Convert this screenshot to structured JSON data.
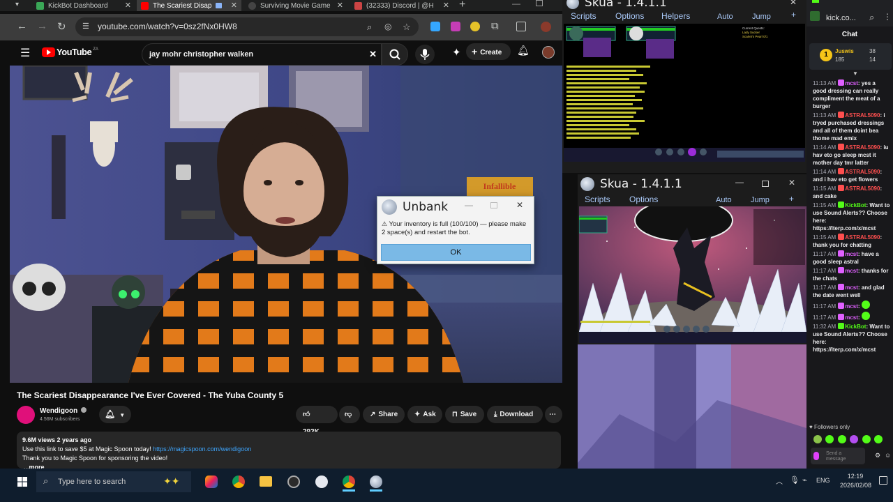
{
  "browser": {
    "tabs": [
      {
        "label": "KickBot Dashboard",
        "color": "#3aa757"
      },
      {
        "label": "The Scariest Disap",
        "color": "#ff0000"
      },
      {
        "label": "Surviving Movie Game",
        "color": "#444"
      },
      {
        "label": "(32333) Discord | @H",
        "color": "#5865f2"
      }
    ],
    "url": "youtube.com/watch?v=0sz2fNx0HW8"
  },
  "youtube": {
    "logo": "YouTube",
    "region": "ZA",
    "search_value": "jay mohr christopher walken",
    "create_label": "Create",
    "video_title": "The Scariest Disappearance I've Ever Covered - The Yuba County 5",
    "channel_name": "Wendigoon",
    "subscribers": "4.56M subscribers",
    "likes": "293K",
    "share_label": "Share",
    "ask_label": "Ask",
    "save_label": "Save",
    "download_label": "Download",
    "views_date": "9.6M views  2 years ago",
    "desc_line1": "Use this link to save $5 at Magic Spoon today!",
    "desc_link": "https://magicspoon.com/wendigoon",
    "desc_line2": "Thank you to Magic Spoon for sponsoring the video!",
    "more": "...more",
    "poster_text": "Infallible"
  },
  "dialog": {
    "title": "Unbank",
    "message": "Your inventory is full (100/100) — please make 2 space(s) and restart the bot.",
    "ok_label": "OK"
  },
  "skua1": {
    "title": "Skua - 1.4.1.1",
    "menu": [
      "Scripts",
      "Options",
      "Helpers"
    ],
    "auto": "Auto",
    "jump": "Jump",
    "quest_title": "Current Quests:",
    "quests": [
      "Lady Sucker",
      "Scarlet's Pearl 0/1"
    ]
  },
  "skua2": {
    "title": "Skua - 1.4.1.1",
    "menu": [
      "Scripts",
      "Options"
    ],
    "auto": "Auto",
    "jump": "Jump"
  },
  "chat": {
    "header": "kick.co...",
    "title": "Chat",
    "pinned_user": "Juswis",
    "pinned_stats": [
      "38",
      "185",
      "14"
    ],
    "messages": [
      {
        "time": "11:13 AM",
        "user": "mcst",
        "color": "#e060ff",
        "text": "yes a good dressing can really compliment the meat of a burger"
      },
      {
        "time": "11:13 AM",
        "user": "ASTRAL5090",
        "color": "#ff4f4f",
        "text": "i tryed purchased dressings and all of them doint bea thome mad emix"
      },
      {
        "time": "11:14 AM",
        "user": "ASTRAL5090",
        "color": "#ff4f4f",
        "text": "iu hav eto go sleep mcst it mother day tmr latter"
      },
      {
        "time": "11:14 AM",
        "user": "ASTRAL5090",
        "color": "#ff4f4f",
        "text": "and i hav eto get flowers"
      },
      {
        "time": "11:15 AM",
        "user": "ASTRAL5090",
        "color": "#ff4f4f",
        "text": "and cake"
      },
      {
        "time": "11:15 AM",
        "user": "KickBot",
        "color": "#53fc18",
        "text": "Want to use Sound Alerts?? Choose here: https://lterp.com/x/mcst"
      },
      {
        "time": "11:15 AM",
        "user": "ASTRAL5090",
        "color": "#ff4f4f",
        "text": "thank you for chatting"
      },
      {
        "time": "11:17 AM",
        "user": "mcst",
        "color": "#e060ff",
        "text": "have a good sleep astral"
      },
      {
        "time": "11:17 AM",
        "user": "mcst",
        "color": "#e060ff",
        "text": "thanks for the chats"
      },
      {
        "time": "11:17 AM",
        "user": "mcst",
        "color": "#e060ff",
        "text": "and glad the date went well"
      },
      {
        "time": "11:17 AM",
        "user": "mcst",
        "color": "#e060ff",
        "text": ""
      },
      {
        "time": "11:17 AM",
        "user": "mcst",
        "color": "#e060ff",
        "text": ""
      },
      {
        "time": "11:32 AM",
        "user": "KickBot",
        "color": "#53fc18",
        "text": "Want to use Sound Alerts?? Choose here: https://lterp.com/x/mcst"
      }
    ],
    "followers_only": "Followers only",
    "send_placeholder": "Send a message"
  },
  "taskbar": {
    "search_placeholder": "Type here to search",
    "lang": "ENG",
    "time": "12:19",
    "date": "2026/02/08"
  }
}
